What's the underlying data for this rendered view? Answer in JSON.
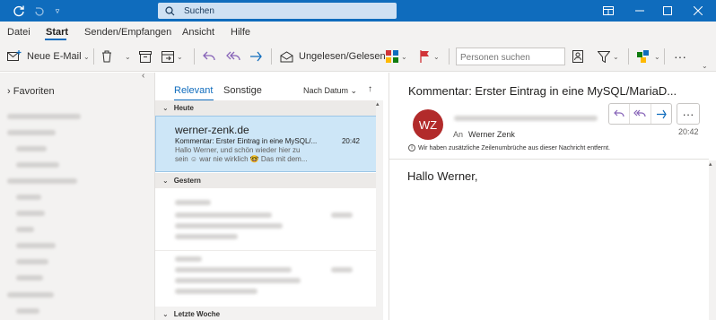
{
  "titlebar": {
    "search_placeholder": "Suchen",
    "icons": [
      "sync-icon",
      "undo-icon",
      "customize-quick-access-icon",
      "search-icon",
      "layout-icon",
      "minimize-icon",
      "maximize-icon",
      "close-icon"
    ],
    "accent": "#0f6cbd"
  },
  "menu": {
    "items": [
      "Datei",
      "Start",
      "Senden/Empfangen",
      "Ansicht",
      "Hilfe"
    ],
    "active": "Start"
  },
  "toolbar": {
    "new_email": "Neue E-Mail",
    "unread_read": "Ungelesen/Gelesen",
    "people_search_placeholder": "Personen suchen",
    "more": "···"
  },
  "folders": {
    "favorites_label": "Favoriten"
  },
  "list": {
    "tabs": [
      "Relevant",
      "Sonstige"
    ],
    "active_tab": "Relevant",
    "sort_label": "Nach Datum",
    "groups": {
      "today": "Heute",
      "yesterday": "Gestern",
      "last_week": "Letzte Woche"
    },
    "selected_message": {
      "sender": "werner-zenk.de",
      "subject": "Kommentar: Erster Eintrag in eine MySQL/...",
      "time": "20:42",
      "preview_line1": "Hallo Werner,  und schön wieder hier zu",
      "preview_line2": "sein ☺ war nie wirklich 🤓  Das mit dem..."
    }
  },
  "reading": {
    "subject": "Kommentar: Erster Eintrag in eine MySQL/MariaD...",
    "avatar_initials": "WZ",
    "avatar_color": "#b22b2b",
    "to_label": "An",
    "to_name": "Werner Zenk",
    "date": "20:42",
    "info_text": "Wir haben zusätzliche Zeilenumbrüche aus dieser Nachricht entfernt.",
    "greeting": "Hallo Werner,",
    "more": "···"
  }
}
